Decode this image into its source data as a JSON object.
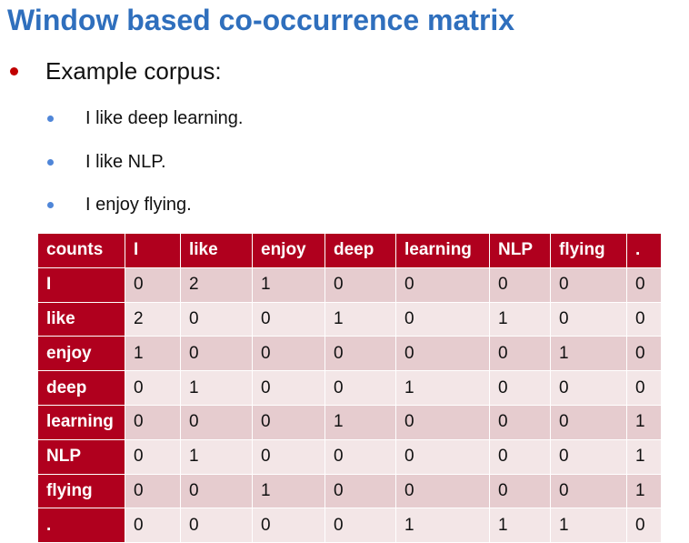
{
  "title": "Window based co-occurrence matrix",
  "bullet": "Example corpus:",
  "corpus": [
    "I like deep learning.",
    "I like NLP.",
    "I enjoy flying."
  ],
  "table": {
    "headers": [
      "counts",
      "I",
      "like",
      "enjoy",
      "deep",
      "learning",
      "NLP",
      "flying",
      "."
    ],
    "rows": [
      {
        "label": "I",
        "values": [
          "0",
          "2",
          "1",
          "0",
          "0",
          "0",
          "0",
          "0"
        ]
      },
      {
        "label": "like",
        "values": [
          "2",
          "0",
          "0",
          "1",
          "0",
          "1",
          "0",
          "0"
        ]
      },
      {
        "label": "enjoy",
        "values": [
          "1",
          "0",
          "0",
          "0",
          "0",
          "0",
          "1",
          "0"
        ]
      },
      {
        "label": "deep",
        "values": [
          "0",
          "1",
          "0",
          "0",
          "1",
          "0",
          "0",
          "0"
        ]
      },
      {
        "label": "learning",
        "values": [
          "0",
          "0",
          "0",
          "1",
          "0",
          "0",
          "0",
          "1"
        ]
      },
      {
        "label": "NLP",
        "values": [
          "0",
          "1",
          "0",
          "0",
          "0",
          "0",
          "0",
          "1"
        ]
      },
      {
        "label": "flying",
        "values": [
          "0",
          "0",
          "1",
          "0",
          "0",
          "0",
          "0",
          "1"
        ]
      },
      {
        "label": ".",
        "values": [
          "0",
          "0",
          "0",
          "0",
          "1",
          "1",
          "1",
          "0"
        ]
      }
    ]
  },
  "colors": {
    "title": "#2f6fbd",
    "main_bullet": "#c00000",
    "sub_bullet": "#4f86d8",
    "table_header": "#b0001e",
    "row_dark": "#e6cccf",
    "row_light": "#f3e6e7"
  }
}
